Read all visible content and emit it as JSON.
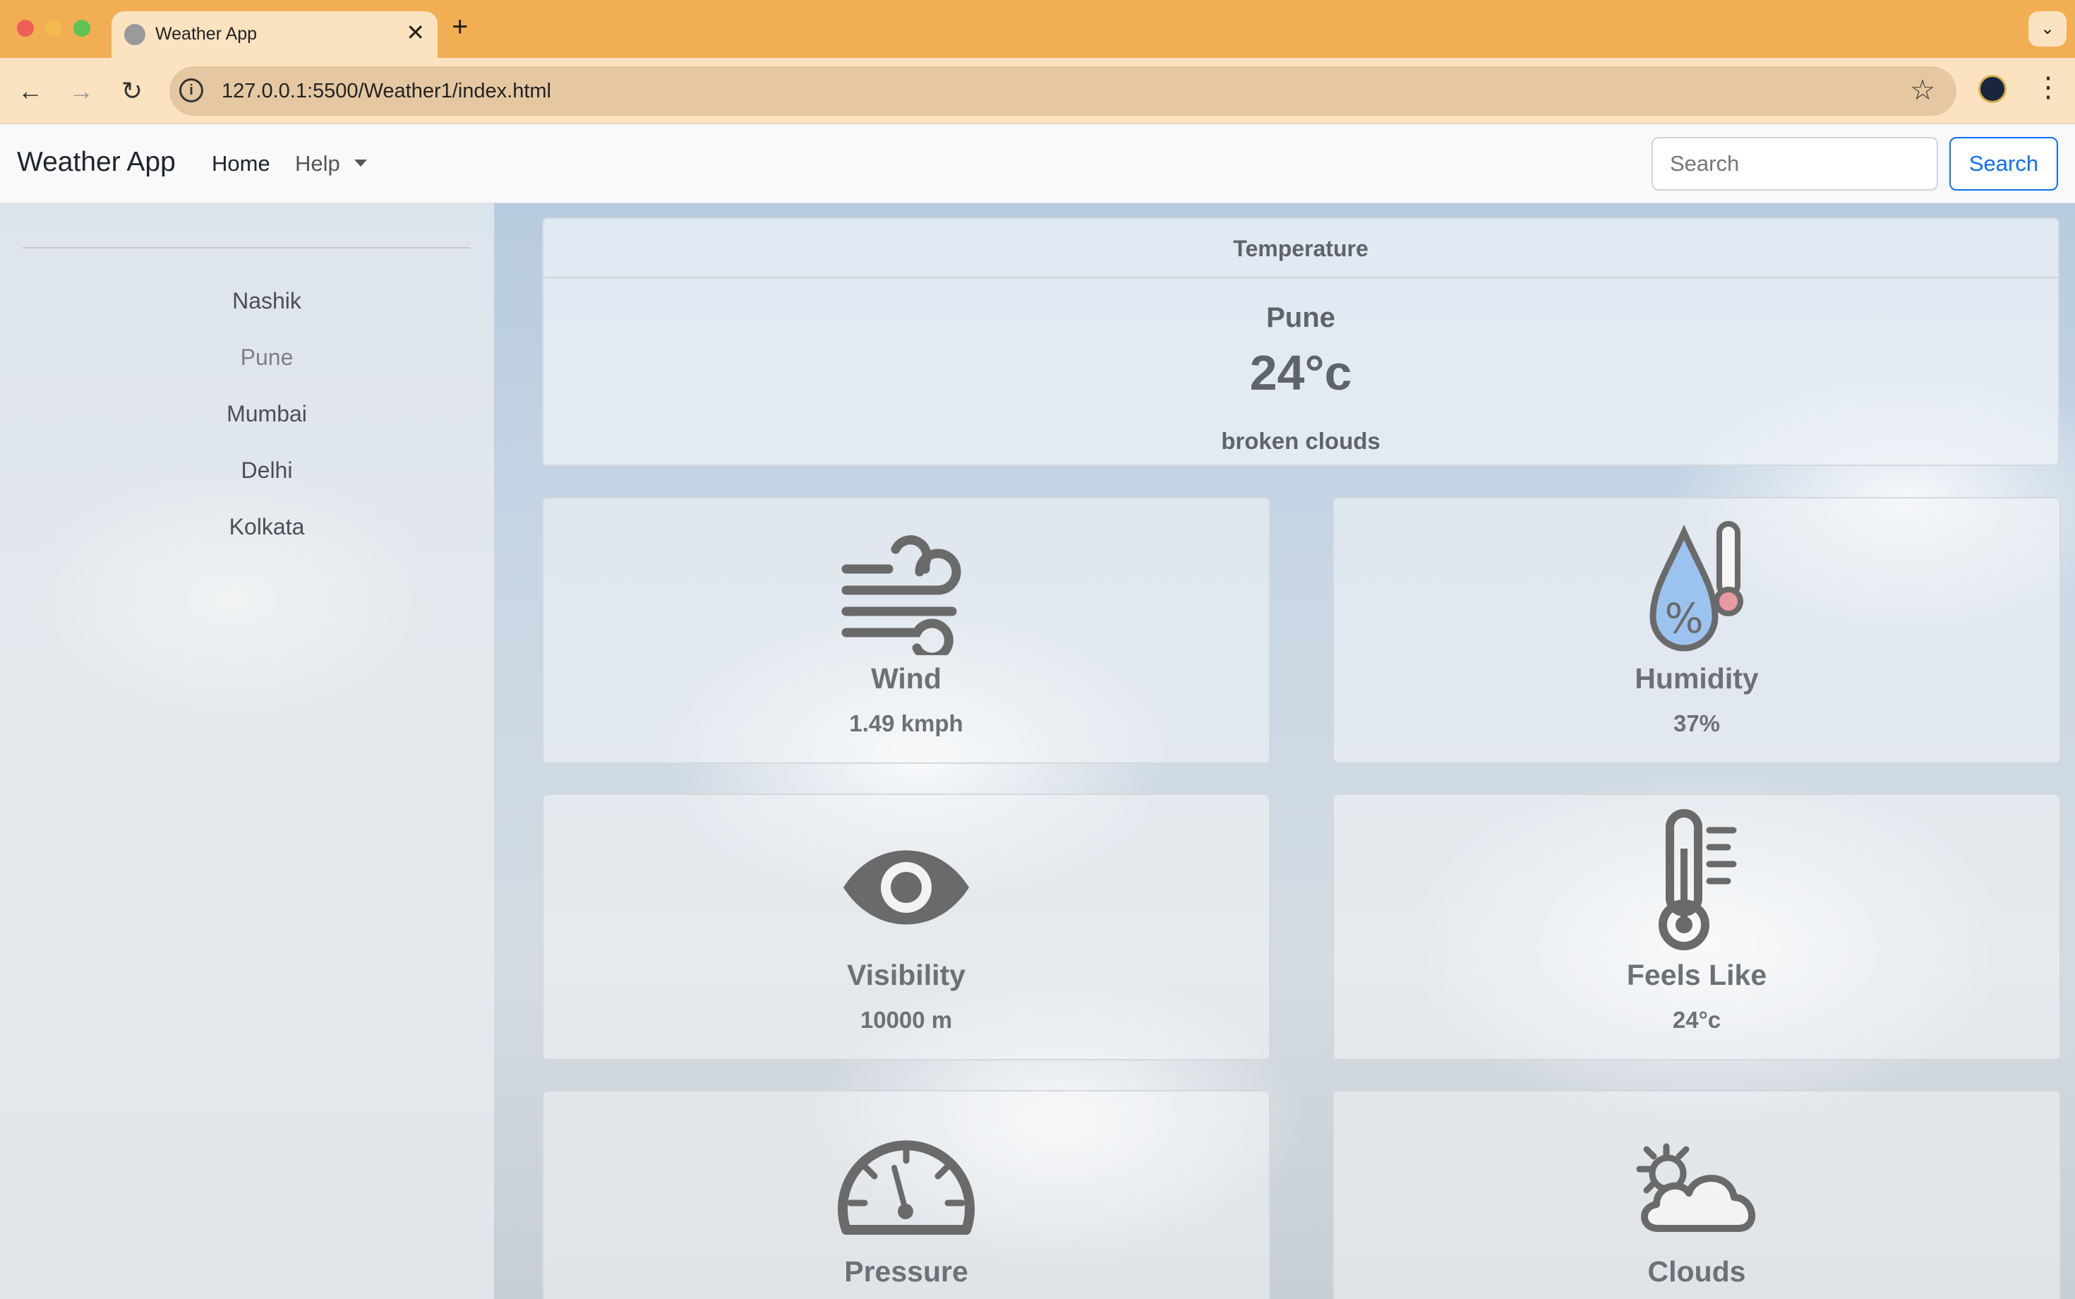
{
  "browser": {
    "tab_title": "Weather App",
    "url": "127.0.0.1:5500/Weather1/index.html"
  },
  "navbar": {
    "brand": "Weather App",
    "home": "Home",
    "help": "Help",
    "search_placeholder": "Search",
    "search_button": "Search"
  },
  "sidebar": {
    "cities": [
      "Nashik",
      "Pune",
      "Mumbai",
      "Delhi",
      "Kolkata"
    ]
  },
  "temperature": {
    "header": "Temperature",
    "city": "Pune",
    "value": "24°c",
    "description": "broken clouds"
  },
  "metrics": {
    "wind": {
      "title": "Wind",
      "value": "1.49 kmph",
      "icon": "wind-icon"
    },
    "humidity": {
      "title": "Humidity",
      "value": "37%",
      "icon": "humidity-icon"
    },
    "visibility": {
      "title": "Visibility",
      "value": "10000 m",
      "icon": "eye-icon"
    },
    "feels_like": {
      "title": "Feels Like",
      "value": "24°c",
      "icon": "thermometer-icon"
    },
    "pressure": {
      "title": "Pressure",
      "icon": "gauge-icon"
    },
    "clouds": {
      "title": "Clouds",
      "icon": "cloud-sun-icon"
    }
  },
  "colors": {
    "tabbar": "#f2ae52",
    "toolbar": "#fbe3c2",
    "accent": "#0d6efd",
    "humidity_fill": "#9cc3ef"
  }
}
